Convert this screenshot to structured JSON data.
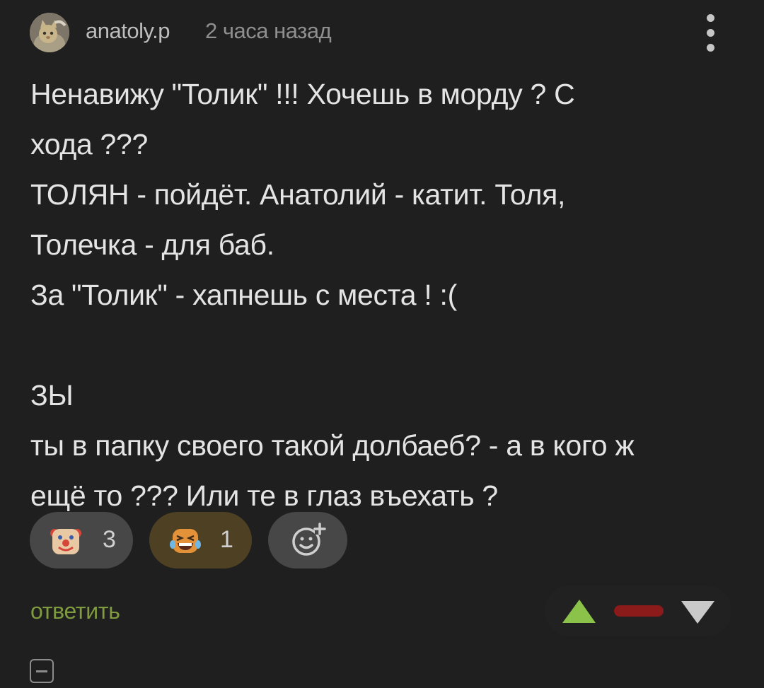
{
  "comment": {
    "author": "anatoly.p",
    "time_ago": "2 часа назад",
    "avatar_icon": "avatar-cat-icon",
    "menu_icon": "kebab-menu-icon",
    "body_lines": [
      "Ненавижу \"Толик\" !!! Хочешь в морду ? С",
      "хода ???",
      "ТОЛЯН - пойдёт. Анатолий - катит. Толя,",
      "Толечка - для баб.",
      "За \"Толик\" - хапнешь с места ! :(",
      "",
      "ЗЫ",
      "ты в папку своего такой долбаеб? - а в кого ж",
      "ещё то ??? Или те в глаз въехать ?"
    ]
  },
  "reactions": [
    {
      "icon": "clown-face-icon",
      "count": "3",
      "active": false
    },
    {
      "icon": "laughing-tears-face-icon",
      "count": "1",
      "active": true
    },
    {
      "icon": "add-reaction-smile-icon",
      "count": "",
      "active": false
    }
  ],
  "actions": {
    "reply_label": "ответить",
    "upvote_icon": "upvote-triangle-icon",
    "rating_bar_icon": "rating-bar-icon",
    "downvote_icon": "downvote-triangle-icon",
    "collapse_icon": "collapse-minus-icon"
  },
  "colors": {
    "background": "#1f1f1f",
    "reply_green": "#7f9a3f",
    "upvote_green": "#8bc34a",
    "rating_red": "#8b1a1a",
    "active_reaction_bg": "#4e4023",
    "reaction_bg": "#474747"
  }
}
